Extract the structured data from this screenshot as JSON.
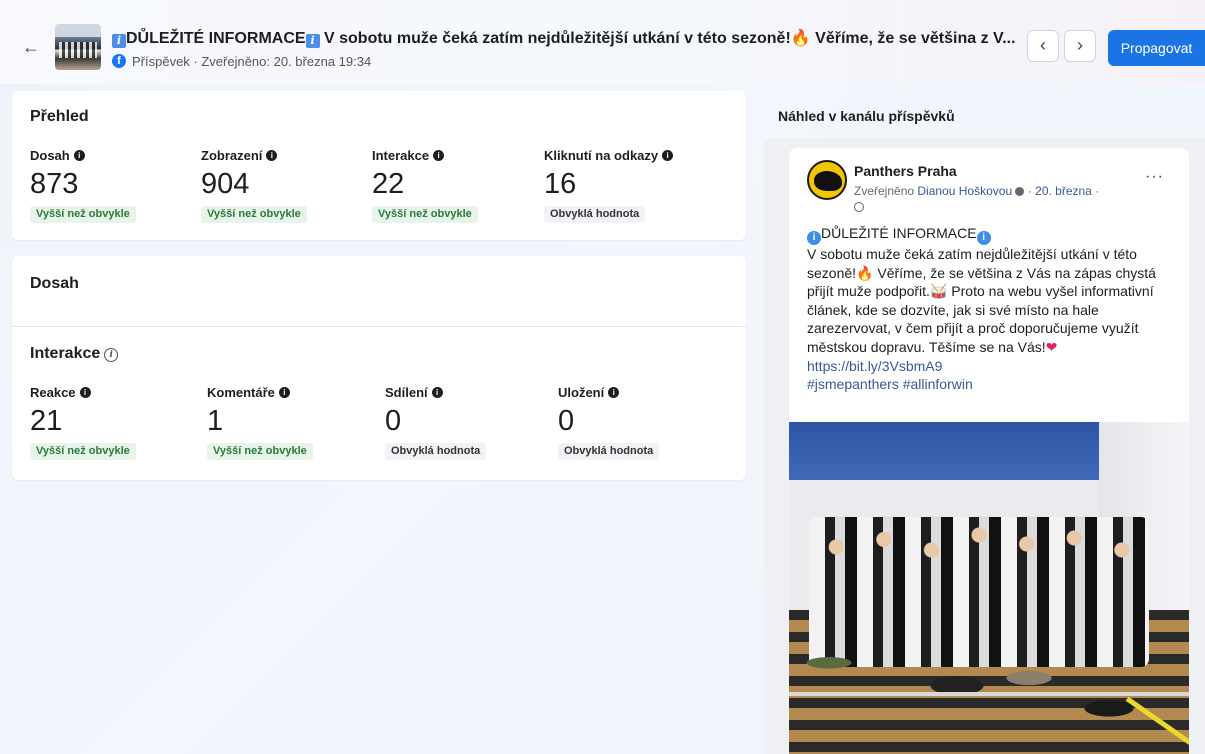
{
  "header": {
    "title_prefix": "DŮLEŽITÉ INFORMACE",
    "title_rest": "V sobotu muže čeká zatím nejdůležitější utkání v této sezoně!",
    "title_tail": "Věříme, že se většina z V...",
    "subtitle": "Příspěvek · Zveřejněno: 20. března 19:34",
    "promote_label": "Propagovat",
    "info_glyph": "i",
    "fire_glyph": "🔥"
  },
  "overview": {
    "title": "Přehled",
    "metrics": [
      {
        "label": "Dosah",
        "value": "873",
        "badge": "Vyšší než obvykle"
      },
      {
        "label": "Zobrazení",
        "value": "904",
        "badge": "Vyšší než obvykle"
      },
      {
        "label": "Interakce",
        "value": "22",
        "badge": "Vyšší než obvykle"
      },
      {
        "label": "Kliknutí na odkazy",
        "value": "16",
        "badge": "Obvyklá hodnota"
      }
    ]
  },
  "reach": {
    "title": "Dosah"
  },
  "interactions": {
    "title": "Interakce",
    "metrics": [
      {
        "label": "Reakce",
        "value": "21",
        "badge": "Vyšší než obvykle"
      },
      {
        "label": "Komentáře",
        "value": "1",
        "badge": "Vyšší než obvykle"
      },
      {
        "label": "Sdílení",
        "value": "0",
        "badge": "Obvyklá hodnota"
      },
      {
        "label": "Uložení",
        "value": "0",
        "badge": "Obvyklá hodnota"
      }
    ]
  },
  "preview": {
    "title": "Náhled v kanálu příspěvků",
    "page_name": "Panthers Praha",
    "meta_prefix": "Zveřejněno",
    "meta_author": "Dianou Hoškovou",
    "meta_date": "20. března",
    "more": "···",
    "body_heading": "DŮLEŽITÉ INFORMACE",
    "body_text_1": "V sobotu muže čeká zatím nejdůležitější utkání v této sezoně!",
    "body_text_2": " Věříme, že se většina z Vás na zápas chystá přijít muže podpořit.",
    "body_text_3": " Proto na webu vyšel informativní článek, kde se dozvíte, jak si své místo na hale zarezervovat, v čem přijít a proč doporučujeme využít městskou dopravu. Těšíme se na Vás!",
    "drum": "🥁",
    "heart": "❤",
    "link": "https://bit.ly/3VsbmA9",
    "hashtags": "#jsmepanthers #allinforwin"
  },
  "colors": {
    "accent": "#1b74e4",
    "higher_badge_bg": "#e6f4ea",
    "higher_badge_text": "#2b7a3b",
    "normal_badge_bg": "#f0f2f5"
  }
}
